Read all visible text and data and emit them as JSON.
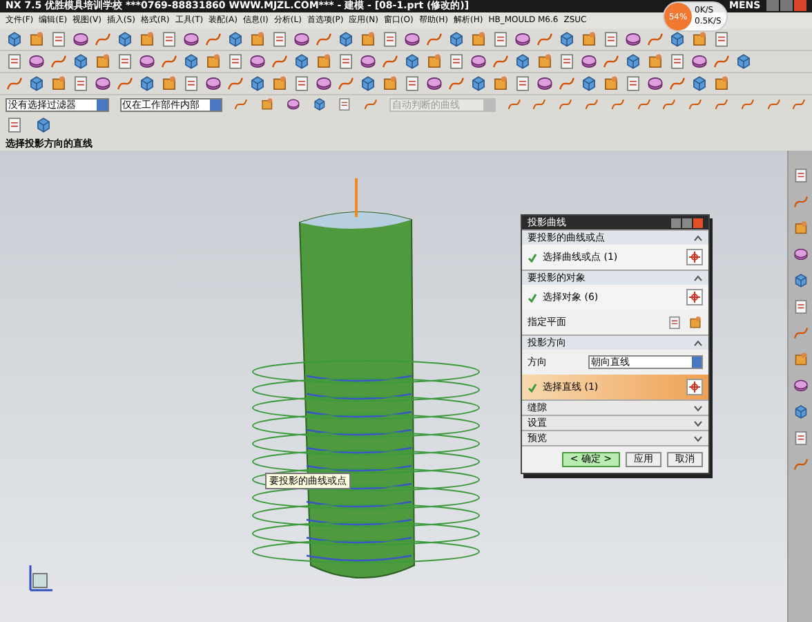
{
  "window": {
    "title": "NX 7.5 优胜模具培训学校 ***0769-88831860 WWW.MJZL.COM*** - 建模 - [08-1.prt (修改的)]",
    "brand": "MENS"
  },
  "net_meter": {
    "badge": "54%",
    "upload": "0K/S",
    "download": "0.5K/S"
  },
  "menu": [
    "文件(F)",
    "编辑(E)",
    "视图(V)",
    "插入(S)",
    "格式(R)",
    "工具(T)",
    "装配(A)",
    "信息(I)",
    "分析(L)",
    "首选项(P)",
    "应用(N)",
    "窗口(O)",
    "帮助(H)",
    "解析(H)",
    "HB_MOULD M6.6",
    "ZSUC"
  ],
  "filters": [
    {
      "value": "没有选择过滤器",
      "disabled": false
    },
    {
      "value": "仅在工作部件内部",
      "disabled": false
    },
    {
      "value": "自动判断的曲线",
      "disabled": true
    }
  ],
  "status_bar": "选择投影方向的直线",
  "tooltip": "要投影的曲线或点",
  "dialog": {
    "title": "投影曲线",
    "sections": [
      {
        "title": "要投影的曲线或点",
        "expanded": true,
        "rows": [
          {
            "kind": "selection",
            "label": "选择曲线或点 (1)",
            "active": false
          }
        ]
      },
      {
        "title": "要投影的对象",
        "expanded": true,
        "rows": [
          {
            "kind": "selection",
            "label": "选择对象 (6)",
            "active": false
          },
          {
            "kind": "plane",
            "label": "指定平面"
          }
        ]
      },
      {
        "title": "投影方向",
        "expanded": true,
        "rows": [
          {
            "kind": "dropdown",
            "label": "方向",
            "value": "朝向直线"
          },
          {
            "kind": "selection",
            "label": "选择直线 (1)",
            "active": true
          }
        ]
      },
      {
        "title": "缝隙",
        "expanded": false
      },
      {
        "title": "设置",
        "expanded": false
      },
      {
        "title": "预览",
        "expanded": false
      }
    ],
    "buttons": [
      {
        "label": "< 确定 >",
        "default": true
      },
      {
        "label": "应用",
        "default": false
      },
      {
        "label": "取消",
        "default": false
      }
    ]
  }
}
